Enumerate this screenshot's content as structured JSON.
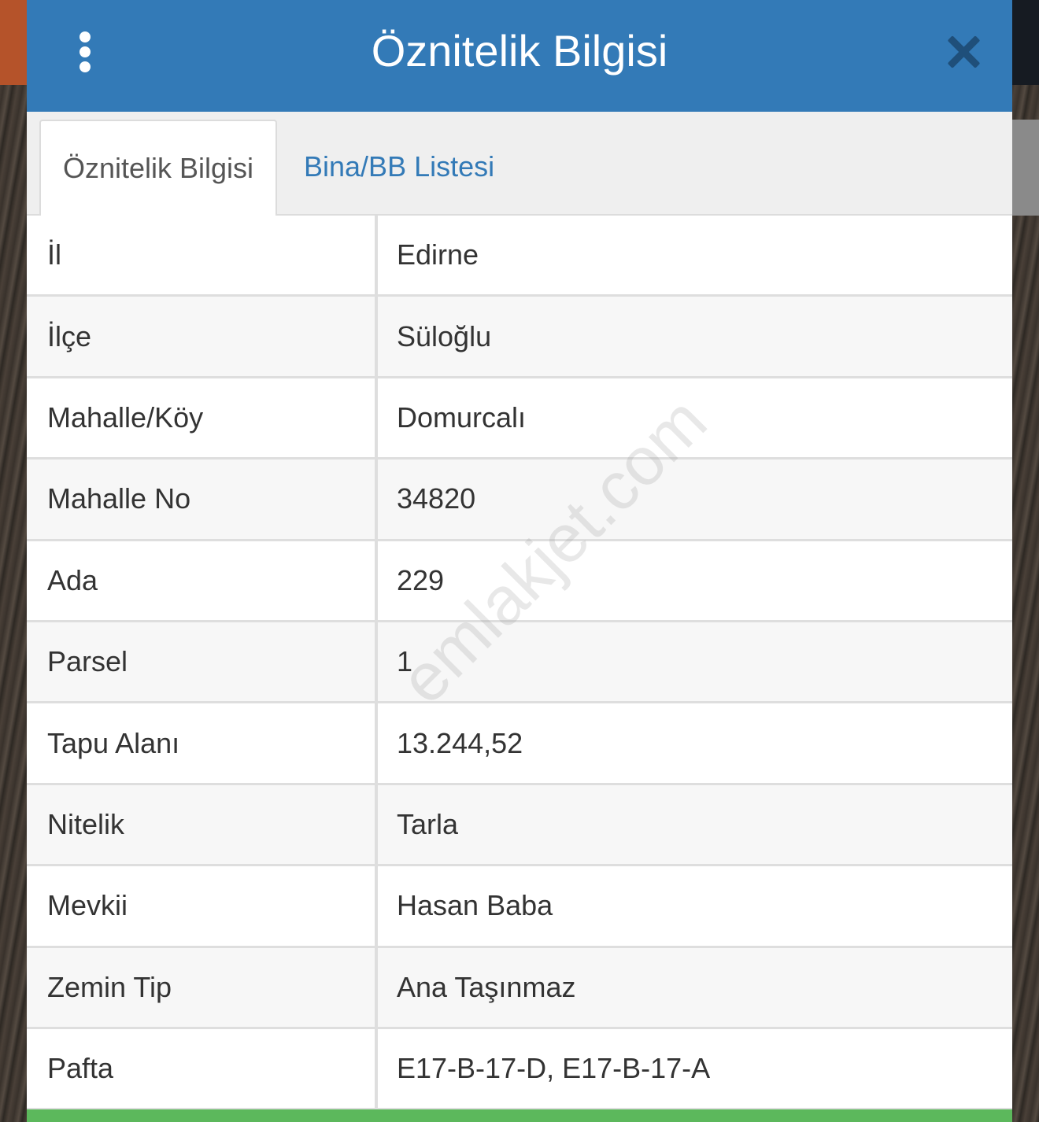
{
  "header": {
    "title": "Öznitelik Bilgisi",
    "header_color": "#337ab7"
  },
  "tabs": [
    {
      "label": "Öznitelik Bilgisi",
      "active": true
    },
    {
      "label": "Bina/BB Listesi",
      "active": false
    }
  ],
  "attributes": [
    {
      "key": "İl",
      "value": "Edirne"
    },
    {
      "key": "İlçe",
      "value": "Süloğlu"
    },
    {
      "key": "Mahalle/Köy",
      "value": "Domurcalı"
    },
    {
      "key": "Mahalle No",
      "value": "34820"
    },
    {
      "key": "Ada",
      "value": "229"
    },
    {
      "key": "Parsel",
      "value": "1"
    },
    {
      "key": "Tapu Alanı",
      "value": "13.244,52"
    },
    {
      "key": "Nitelik",
      "value": "Tarla"
    },
    {
      "key": "Mevkii",
      "value": "Hasan Baba"
    },
    {
      "key": "Zemin Tip",
      "value": "Ana Taşınmaz"
    },
    {
      "key": "Pafta",
      "value": "E17-B-17-D, E17-B-17-A"
    }
  ],
  "watermark": "emlakjet.com",
  "icons": {
    "menu": "vertical-dots-menu-icon",
    "close": "close-x-icon"
  },
  "colors": {
    "accent": "#337ab7",
    "footer": "#5cb85c"
  }
}
